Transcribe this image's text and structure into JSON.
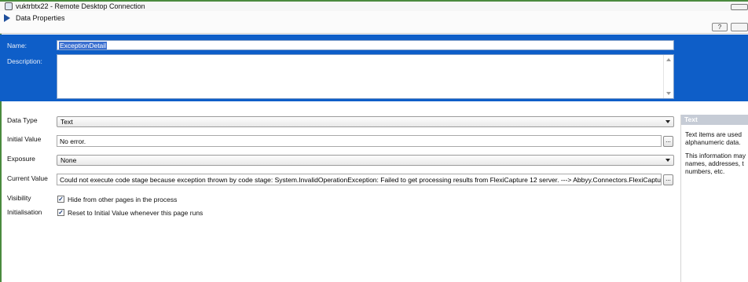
{
  "window": {
    "title": "vuktrbtx22 - Remote Desktop Connection"
  },
  "dialog": {
    "title": "Data Properties",
    "help_glyph": "?"
  },
  "header": {
    "name_label": "Name:",
    "name_value": "ExceptionDetail",
    "description_label": "Description:",
    "description_value": ""
  },
  "form": {
    "data_type": {
      "label": "Data Type",
      "value": "Text"
    },
    "initial_value": {
      "label": "Initial Value",
      "value": "No error.",
      "button": "..."
    },
    "exposure": {
      "label": "Exposure",
      "value": "None"
    },
    "current_value": {
      "label": "Current Value",
      "value": "Could not execute code stage because exception thrown by code stage: System.InvalidOperationException: Failed to get processing results from FlexiCapture 12 server. ---> Abbyy.Connectors.FlexiCaptureConnector.FlexiC",
      "button": "..."
    },
    "visibility": {
      "label": "Visibility",
      "checkbox_label": "Hide from other pages in the process",
      "checked": true
    },
    "initialisation": {
      "label": "Initialisation",
      "checkbox_label": "Reset to Initial Value whenever this page runs",
      "checked": true
    }
  },
  "help_panel": {
    "title": "Text",
    "lines": [
      "Text items are used",
      "alphanumeric data.",
      "This information may",
      "names, addresses, t",
      "numbers, etc."
    ]
  },
  "colors": {
    "header_blue": "#0e5ec8",
    "help_title_bg": "#c6ccd6"
  }
}
